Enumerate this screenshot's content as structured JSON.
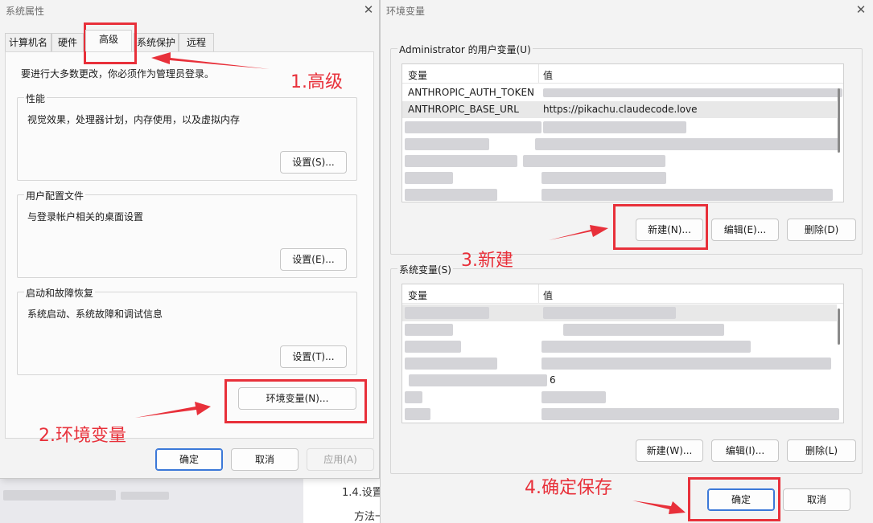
{
  "background": {
    "text_line_1": "1.4.设置",
    "text_line_2": "方法一"
  },
  "system_properties": {
    "title": "系统属性",
    "close_glyph": "✕",
    "tabs": [
      {
        "label": "计算机名"
      },
      {
        "label": "硬件"
      },
      {
        "label": "高级",
        "active": true
      },
      {
        "label": "系统保护"
      },
      {
        "label": "远程"
      }
    ],
    "admin_note": "要进行大多数更改，你必须作为管理员登录。",
    "groups": [
      {
        "legend": "性能",
        "description": "视觉效果，处理器计划，内存使用，以及虚拟内存",
        "button": "设置(S)..."
      },
      {
        "legend": "用户配置文件",
        "description": "与登录帐户相关的桌面设置",
        "button": "设置(E)..."
      },
      {
        "legend": "启动和故障恢复",
        "description": "系统启动、系统故障和调试信息",
        "button": "设置(T)..."
      }
    ],
    "env_button": "环境变量(N)...",
    "footer": {
      "ok": "确定",
      "cancel": "取消",
      "apply": "应用(A)"
    }
  },
  "environment_variables": {
    "title": "环境变量",
    "close_glyph": "✕",
    "user_section": {
      "legend": "Administrator 的用户变量(U)",
      "columns": [
        "变量",
        "值"
      ],
      "rows": [
        {
          "name": "ANTHROPIC_AUTH_TOKEN",
          "value": ""
        },
        {
          "name": "ANTHROPIC_BASE_URL",
          "value": "https://pikachu.claudecode.love"
        }
      ],
      "buttons": {
        "new": "新建(N)...",
        "edit": "编辑(E)...",
        "delete": "删除(D)"
      }
    },
    "system_section": {
      "legend": "系统变量(S)",
      "columns": [
        "变量",
        "值"
      ],
      "visible_fragments": [
        "6"
      ],
      "buttons": {
        "new": "新建(W)...",
        "edit": "编辑(I)...",
        "delete": "删除(L)"
      }
    },
    "footer": {
      "ok": "确定",
      "cancel": "取消"
    }
  },
  "annotations": {
    "step1": "1.高级",
    "step2": "2.环境变量",
    "step3": "3.新建",
    "step4": "4.确定保存",
    "color": "#e8303a"
  }
}
